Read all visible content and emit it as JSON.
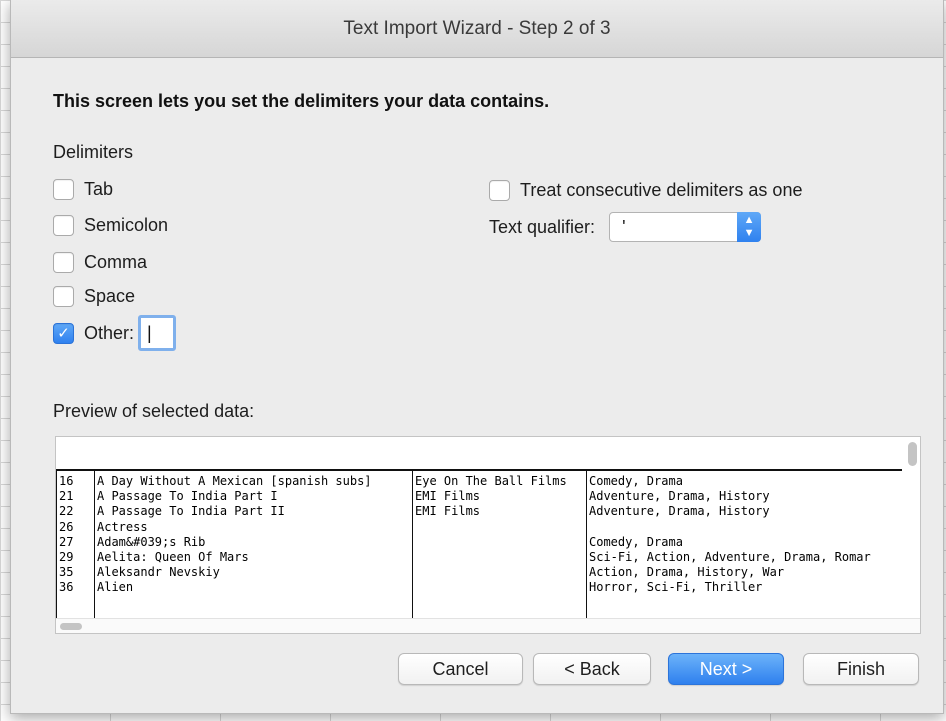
{
  "window": {
    "title": "Text Import Wizard - Step 2 of 3"
  },
  "heading": "This screen lets you set the delimiters your data contains.",
  "delimiters": {
    "label": "Delimiters",
    "tab": {
      "label": "Tab",
      "checked": false
    },
    "semicolon": {
      "label": "Semicolon",
      "checked": false
    },
    "comma": {
      "label": "Comma",
      "checked": false
    },
    "space": {
      "label": "Space",
      "checked": false
    },
    "other": {
      "label": "Other:",
      "checked": true,
      "value": "|"
    }
  },
  "options": {
    "consecutive": {
      "label": "Treat consecutive delimiters as one",
      "checked": false
    },
    "text_qualifier": {
      "label": "Text qualifier:",
      "value": "'"
    }
  },
  "preview": {
    "label": "Preview of selected data:",
    "columns": {
      "id": [
        "16",
        "21",
        "22",
        "26",
        "27",
        "29",
        "35",
        "36"
      ],
      "title": [
        "A Day Without A Mexican [spanish subs]",
        "A Passage To India Part I",
        "A Passage To India Part II",
        "Actress",
        "Adam&#039;s Rib",
        "Aelita: Queen Of Mars",
        "Aleksandr Nevskiy",
        "Alien"
      ],
      "studio": [
        "Eye On The Ball Films",
        "EMI Films",
        "EMI Films",
        "",
        "",
        "",
        "",
        ""
      ],
      "genre": [
        "Comedy, Drama",
        "Adventure, Drama, History",
        "Adventure, Drama, History",
        "",
        "Comedy, Drama",
        "Sci-Fi, Action, Adventure, Drama, Romar",
        "Action, Drama, History, War",
        "Horror, Sci-Fi, Thriller"
      ]
    }
  },
  "buttons": {
    "cancel": "Cancel",
    "back": "< Back",
    "next": "Next >",
    "finish": "Finish"
  },
  "colors": {
    "accent": "#2f81ef"
  }
}
